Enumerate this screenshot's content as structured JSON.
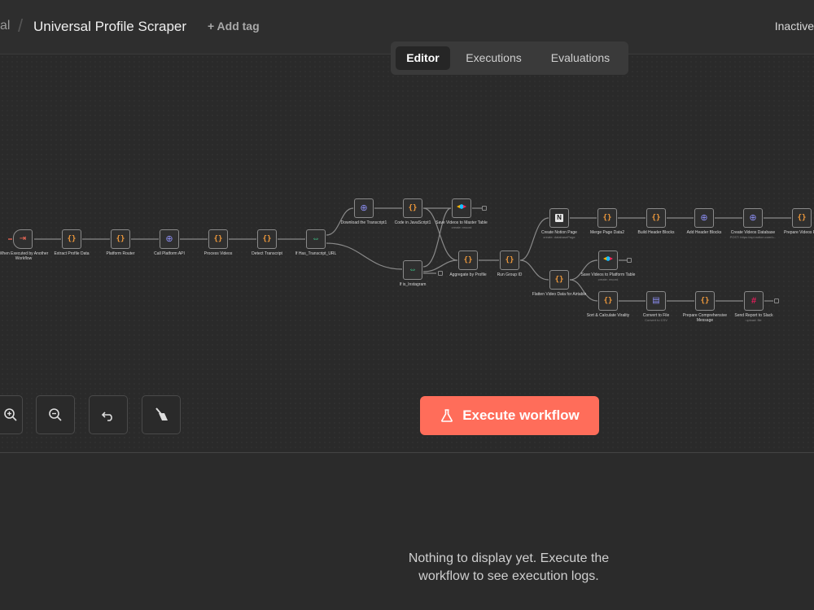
{
  "header": {
    "breadcrumb_folder": "al",
    "workflow_name": "Universal Profile Scraper",
    "add_tag": "+ Add tag",
    "status": "Inactive"
  },
  "tabs": [
    {
      "label": "Editor",
      "active": true
    },
    {
      "label": "Executions",
      "active": false
    },
    {
      "label": "Evaluations",
      "active": false
    }
  ],
  "nodes": {
    "trigger": {
      "label": "When Executed by Another Workflow",
      "icon": "exit-icon"
    },
    "extract": {
      "label": "Extract Profile Data",
      "icon": "code-icon"
    },
    "router": {
      "label": "Platform Router",
      "icon": "code-icon"
    },
    "api": {
      "label": "Call Platform API",
      "icon": "globe-icon"
    },
    "process": {
      "label": "Process Videos",
      "icon": "code-icon"
    },
    "detect": {
      "label": "Detect Transcript",
      "icon": "code-icon"
    },
    "if_url": {
      "label": "If Has_Transcript_URL",
      "icon": "if-icon"
    },
    "download": {
      "label": "Download the Transcript1",
      "icon": "globe-icon"
    },
    "codejs": {
      "label": "Code in JavaScript1",
      "icon": "code-icon"
    },
    "save_master": {
      "label": "Save Videos to Master Table",
      "sub": "create: record",
      "icon": "airtable-icon"
    },
    "if_insta": {
      "label": "If is_Instagram",
      "icon": "if-icon"
    },
    "aggregate": {
      "label": "Aggregate by Profile",
      "icon": "code-icon"
    },
    "rungroup": {
      "label": "Run Group ID",
      "icon": "code-icon"
    },
    "notion": {
      "label": "Create Notion Page",
      "sub": "create: databasePage",
      "icon": "notion-icon"
    },
    "merge": {
      "label": "Merge Page Data2",
      "icon": "code-icon"
    },
    "build": {
      "label": "Build Header Blocks",
      "icon": "code-icon"
    },
    "addheader": {
      "label": "Add Header Blocks",
      "icon": "globe-icon"
    },
    "createdb": {
      "label": "Create Videos Database",
      "sub": "POST: https://api.notion.com/v...",
      "icon": "globe-icon"
    },
    "prepare": {
      "label": "Prepare Videos Pag",
      "icon": "code-icon"
    },
    "flatten": {
      "label": "Flatten Video Data for Airtable",
      "icon": "code-icon"
    },
    "save_platform": {
      "label": "Save Videos to Platform Table",
      "sub": "create: record",
      "icon": "airtable-icon"
    },
    "sort": {
      "label": "Sort & Calculate Virality",
      "icon": "code-icon"
    },
    "convert": {
      "label": "Convert to File",
      "sub": "Convert to CSV",
      "icon": "file-icon"
    },
    "message": {
      "label": "Prepare Comprehensive Message",
      "icon": "code-icon"
    },
    "slack": {
      "label": "Send Report to Slack",
      "sub": "upload: file",
      "icon": "slack-icon"
    }
  },
  "execute_button": "Execute workflow",
  "logs": {
    "empty_message": "Nothing to display yet. Execute the workflow to see execution logs."
  },
  "colors": {
    "accent": "#ff6d5a",
    "code_icon": "#f29b3c",
    "if_icon": "#3fcf8e",
    "globe_icon": "#8d8ff5"
  }
}
